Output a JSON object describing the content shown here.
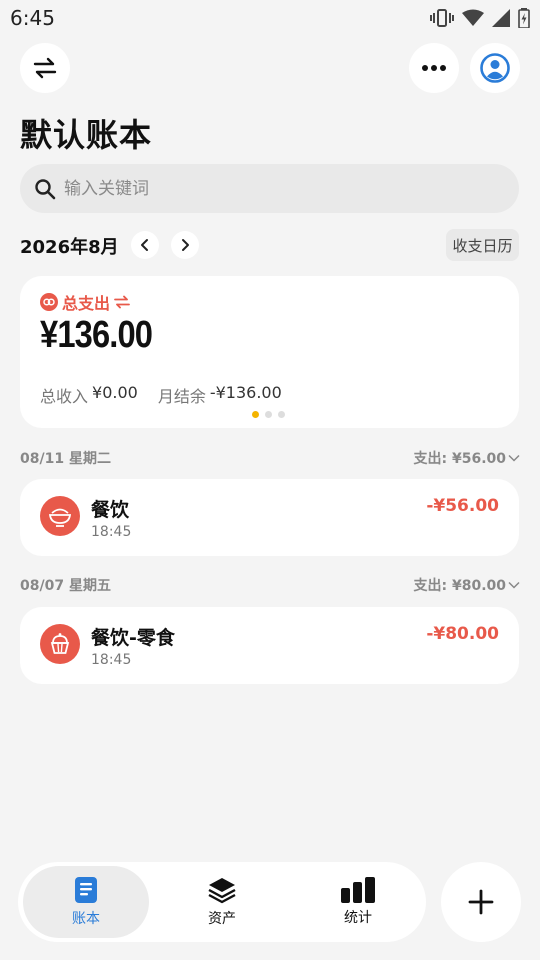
{
  "status_bar": {
    "time": "6:45"
  },
  "header": {
    "title": "默认账本"
  },
  "search": {
    "placeholder": "输入关键词"
  },
  "month": {
    "label": "2026年8月",
    "calendar_label": "收支日历"
  },
  "summary": {
    "label": "总支出",
    "amount": "¥136.00",
    "income_label": "总收入",
    "income_value": "¥0.00",
    "balance_label": "月结余",
    "balance_value": "-¥136.00",
    "page_count": 3,
    "active_page": 0
  },
  "days": [
    {
      "date": "08/11 星期二",
      "total": "支出: ¥56.00",
      "items": [
        {
          "name": "餐饮",
          "time": "18:45",
          "amount": "-¥56.00",
          "icon": "rice-bowl-icon"
        }
      ]
    },
    {
      "date": "08/07 星期五",
      "total": "支出: ¥80.00",
      "items": [
        {
          "name": "餐饮-零食",
          "time": "18:45",
          "amount": "-¥80.00",
          "icon": "cupcake-icon"
        }
      ]
    }
  ],
  "bottom_nav": {
    "items": [
      {
        "label": "账本",
        "icon": "book-icon",
        "active": true
      },
      {
        "label": "资产",
        "icon": "layers-icon",
        "active": false
      },
      {
        "label": "统计",
        "icon": "bar-chart-icon",
        "active": false
      }
    ]
  },
  "colors": {
    "accent": "#2a7cd8",
    "expense": "#e8594a",
    "highlight": "#f4b400",
    "background": "#f4f4f4"
  }
}
